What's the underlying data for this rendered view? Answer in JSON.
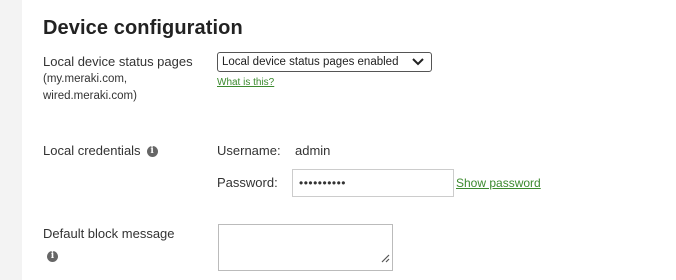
{
  "section": {
    "title": "Device configuration"
  },
  "status_pages": {
    "label": "Local device status pages",
    "sub_label": "(my.meraki.com, wired.meraki.com)",
    "selected_option": "Local device status pages enabled",
    "help_link": "What is this?"
  },
  "credentials": {
    "label": "Local credentials",
    "username_label": "Username:",
    "username_value": "admin",
    "password_label": "Password:",
    "password_value": "••••••••••",
    "show_password_link": "Show password"
  },
  "block_message": {
    "label": "Default block message",
    "value": ""
  },
  "icons": {
    "info": "info-icon",
    "dropdown": "chevron-down-icon",
    "resize": "resize-grip-icon"
  },
  "colors": {
    "link": "#3c8a2e",
    "page_background": "#f3f3f3",
    "panel_background": "#ffffff"
  }
}
